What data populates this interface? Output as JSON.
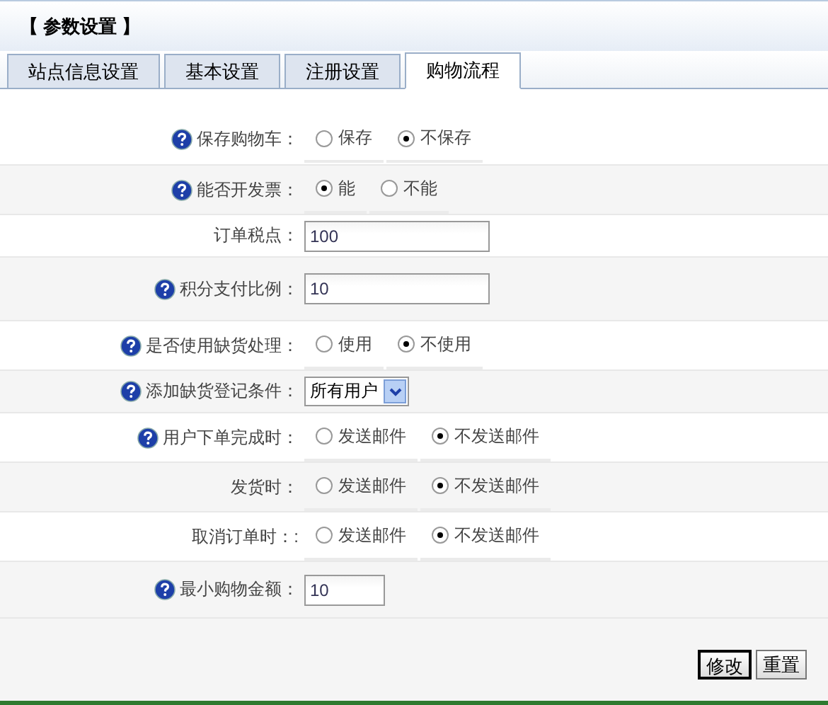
{
  "header": {
    "title": "【 参数设置 】"
  },
  "tabs": [
    {
      "label": "站点信息设置",
      "selected": false
    },
    {
      "label": "基本设置",
      "selected": false
    },
    {
      "label": "注册设置",
      "selected": false
    },
    {
      "label": "购物流程",
      "selected": true
    }
  ],
  "rows": [
    {
      "label": "保存购物车：",
      "help": true,
      "kind": "radio",
      "options": [
        {
          "label": "保存",
          "selected": false
        },
        {
          "label": "不保存",
          "selected": true
        }
      ]
    },
    {
      "label": "能否开发票：",
      "help": true,
      "kind": "radio",
      "options": [
        {
          "label": "能",
          "selected": true
        },
        {
          "label": "不能",
          "selected": false
        }
      ]
    },
    {
      "label": "订单税点：",
      "help": false,
      "kind": "input",
      "value": "100"
    },
    {
      "label": "积分支付比例：",
      "help": true,
      "kind": "input",
      "value": "10"
    },
    {
      "label": "是否使用缺货处理：",
      "help": true,
      "kind": "radio",
      "options": [
        {
          "label": "使用",
          "selected": false
        },
        {
          "label": "不使用",
          "selected": true
        }
      ]
    },
    {
      "label": "添加缺货登记条件：",
      "help": true,
      "kind": "select",
      "value": "所有用户"
    },
    {
      "label": "用户下单完成时：",
      "help": true,
      "kind": "radio",
      "options": [
        {
          "label": "发送邮件",
          "selected": false
        },
        {
          "label": "不发送邮件",
          "selected": true
        }
      ]
    },
    {
      "label": "发货时：",
      "help": false,
      "kind": "radio",
      "options": [
        {
          "label": "发送邮件",
          "selected": false
        },
        {
          "label": "不发送邮件",
          "selected": true
        }
      ]
    },
    {
      "label": "取消订单时：:",
      "help": false,
      "kind": "radio",
      "options": [
        {
          "label": "发送邮件",
          "selected": false
        },
        {
          "label": "不发送邮件",
          "selected": true
        }
      ]
    },
    {
      "label": "最小购物金额：",
      "help": true,
      "kind": "small-input",
      "value": "10"
    }
  ],
  "buttons": [
    {
      "label": "修改",
      "default": true
    },
    {
      "label": "重置",
      "default": false
    }
  ]
}
